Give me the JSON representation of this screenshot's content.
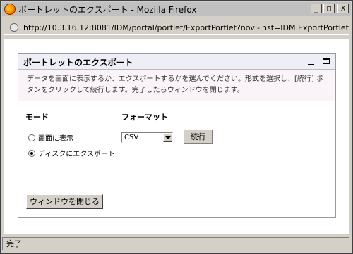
{
  "window": {
    "title": "ポートレットのエクスポート - Mozilla Firefox",
    "buttons": {
      "minimize": "_",
      "maximize": "□",
      "close": "X"
    }
  },
  "address": {
    "url": "http://10.3.16.12:8081/IDM/portal/portlet/ExportPortlet?novl-inst=IDM.ExportPortlet"
  },
  "portlet": {
    "title": "ポートレットのエクスポート",
    "description": "データを画面に表示するか、エクスポートするかを選んでください。形式を選択し、[続行] ボタンをクリックして続行します。完了したらウィンドウを閉じます。",
    "mode_label": "モード",
    "format_label": "フォーマット",
    "mode_options": [
      {
        "label": "画面に表示",
        "checked": false
      },
      {
        "label": "ディスクにエクスポート",
        "checked": true
      }
    ],
    "format_select": {
      "value": "CSV"
    },
    "run_button": "続行",
    "close_button": "ウィンドウを閉じる"
  },
  "status": {
    "text": "完了"
  }
}
